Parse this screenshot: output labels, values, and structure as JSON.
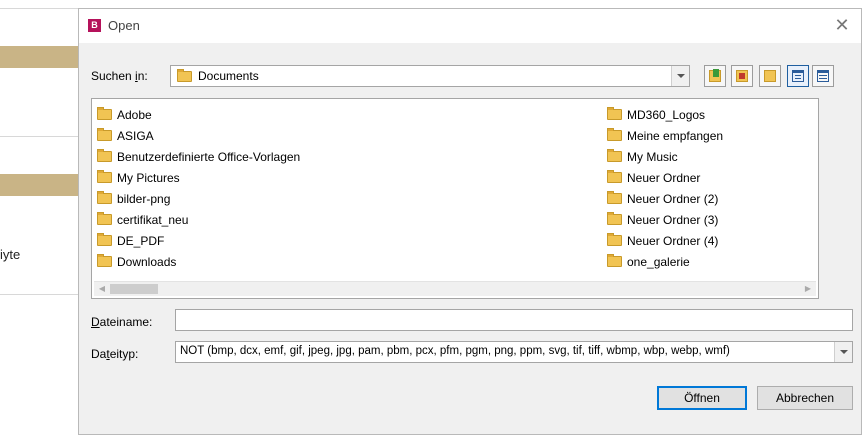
{
  "background": {
    "partial_text": "iyte"
  },
  "dialog": {
    "app_icon_glyph": "B",
    "title": "Open",
    "close_glyph": "✕",
    "lookin_label_pre": "Suchen ",
    "lookin_label_ul": "i",
    "lookin_label_post": "n:",
    "current_folder": "Documents",
    "toolbar": [
      "up-folder-icon",
      "home-folder-icon",
      "new-folder-icon",
      "list-view-icon",
      "details-view-icon"
    ],
    "files_col1": [
      "Adobe",
      "ASIGA",
      "Benutzerdefinierte Office-Vorlagen",
      "My Pictures",
      "bilder-png",
      "certifikat_neu",
      "DE_PDF",
      "Downloads"
    ],
    "files_col2": [
      "MD360_Logos",
      "Meine empfangen",
      "My Music",
      "Neuer Ordner",
      "Neuer Ordner (2)",
      "Neuer Ordner (3)",
      "Neuer Ordner (4)",
      "one_galerie"
    ],
    "filename_label_ul": "D",
    "filename_label_post": "ateiname:",
    "filename_value": "",
    "filetype_label_pre": "Da",
    "filetype_label_ul": "t",
    "filetype_label_post": "eityp:",
    "filetype_value": "NOT (bmp, dcx, emf, gif, jpeg, jpg, pam, pbm, pcx, pfm, pgm, png, ppm, svg, tif, tiff, wbmp, wbp, webp, wmf)",
    "open_button": "Öffnen",
    "cancel_button": "Abbrechen"
  },
  "colors": {
    "accent": "#0078d7",
    "band": "#c9b486",
    "app_icon": "#b5125b",
    "folder": "#f1c453"
  }
}
